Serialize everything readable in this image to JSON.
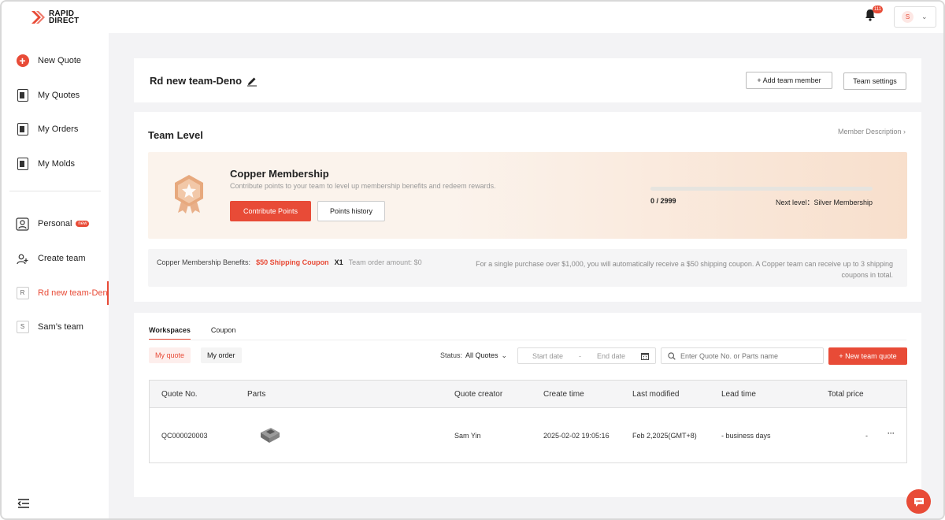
{
  "brand": {
    "line1": "RAPID",
    "line2": "DIRECT",
    "accent": "#e84b37"
  },
  "topbar": {
    "notification_count": "111",
    "user_initial": "S"
  },
  "sidebar": {
    "items": [
      {
        "label": "New Quote",
        "icon": "plus-circle-icon"
      },
      {
        "label": "My Quotes",
        "icon": "quotes-icon"
      },
      {
        "label": "My Orders",
        "icon": "orders-icon"
      },
      {
        "label": "My Molds",
        "icon": "molds-icon"
      },
      {
        "label": "Personal",
        "icon": "person-icon",
        "badge": "new"
      },
      {
        "label": "Create team",
        "icon": "create-team-icon"
      },
      {
        "label": "Rd new team-Deno",
        "icon": "R",
        "active": true
      },
      {
        "label": "Sam’s team",
        "icon": "S"
      }
    ]
  },
  "header": {
    "team_name": "Rd new team-Deno",
    "add_member_label": "+ Add team member",
    "settings_label": "Team settings"
  },
  "team_level": {
    "title": "Team Level",
    "member_description": "Member Description",
    "membership_title": "Copper Membership",
    "membership_subtitle": "Contribute points to your team to level up membership benefits and redeem rewards.",
    "contribute_label": "Contribute Points",
    "history_label": "Points history",
    "progress_text": "0 / 2999",
    "progress_fraction": 0,
    "next_level": "Next level：Silver Membership",
    "benefits_label": "Copper Membership Benefits:",
    "benefit_coupon": "$50 Shipping Coupon",
    "benefit_count": "X1",
    "order_amount": "Team order amount: $0",
    "benefit_note": "For a single purchase over $1,000, you will automatically receive a $50 shipping coupon. A Copper team can receive up to 3 shipping coupons in total."
  },
  "workspace": {
    "tabs": [
      "Workspaces",
      "Coupon"
    ],
    "pills": [
      "My quote",
      "My order"
    ],
    "status_label": "Status:",
    "status_value": "All Quotes",
    "start_date_placeholder": "Start date",
    "date_sep": "-",
    "end_date_placeholder": "End date",
    "search_placeholder": "Enter Quote No. or Parts name",
    "new_quote_label": "+ New team quote",
    "columns": [
      "Quote No.",
      "Parts",
      "Quote creator",
      "Create time",
      "Last modified",
      "Lead time",
      "Total price"
    ],
    "rows": [
      {
        "quote_no": "QC000020003",
        "creator": "Sam Yin",
        "create_time": "2025-02-02 19:05:16",
        "last_modified": "Feb 2,2025(GMT+8)",
        "lead_time": "- business days",
        "total": "-",
        "more": "···"
      }
    ]
  }
}
